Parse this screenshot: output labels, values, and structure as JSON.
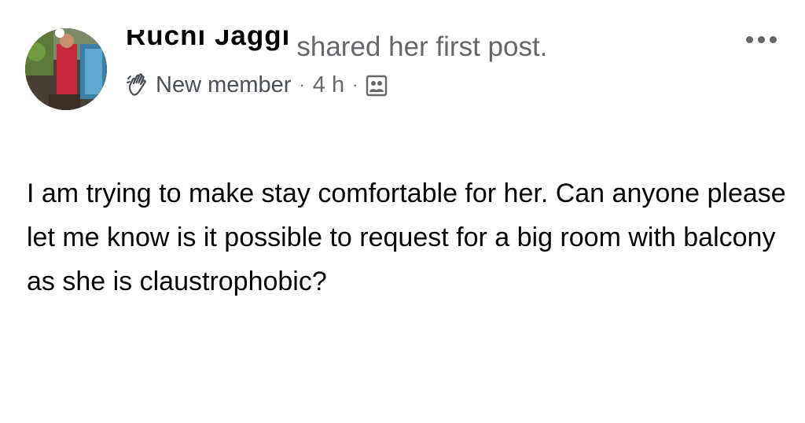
{
  "post": {
    "author": "Ruchi Jaggi",
    "action": "shared her first post.",
    "badge": "New member",
    "separator": "·",
    "time": "4 h",
    "body": "I am trying to make stay comfortable for her. Can anyone please let me know is it possible to request for a big room with balcony as she is claustrophobic?"
  },
  "icons": {
    "badge_icon": "waving-hand-icon",
    "privacy_icon": "members-group-icon",
    "more_icon": "more-options-icon"
  },
  "colors": {
    "secondary_text": "#65676b",
    "primary_text": "#050505",
    "background": "#ffffff"
  }
}
